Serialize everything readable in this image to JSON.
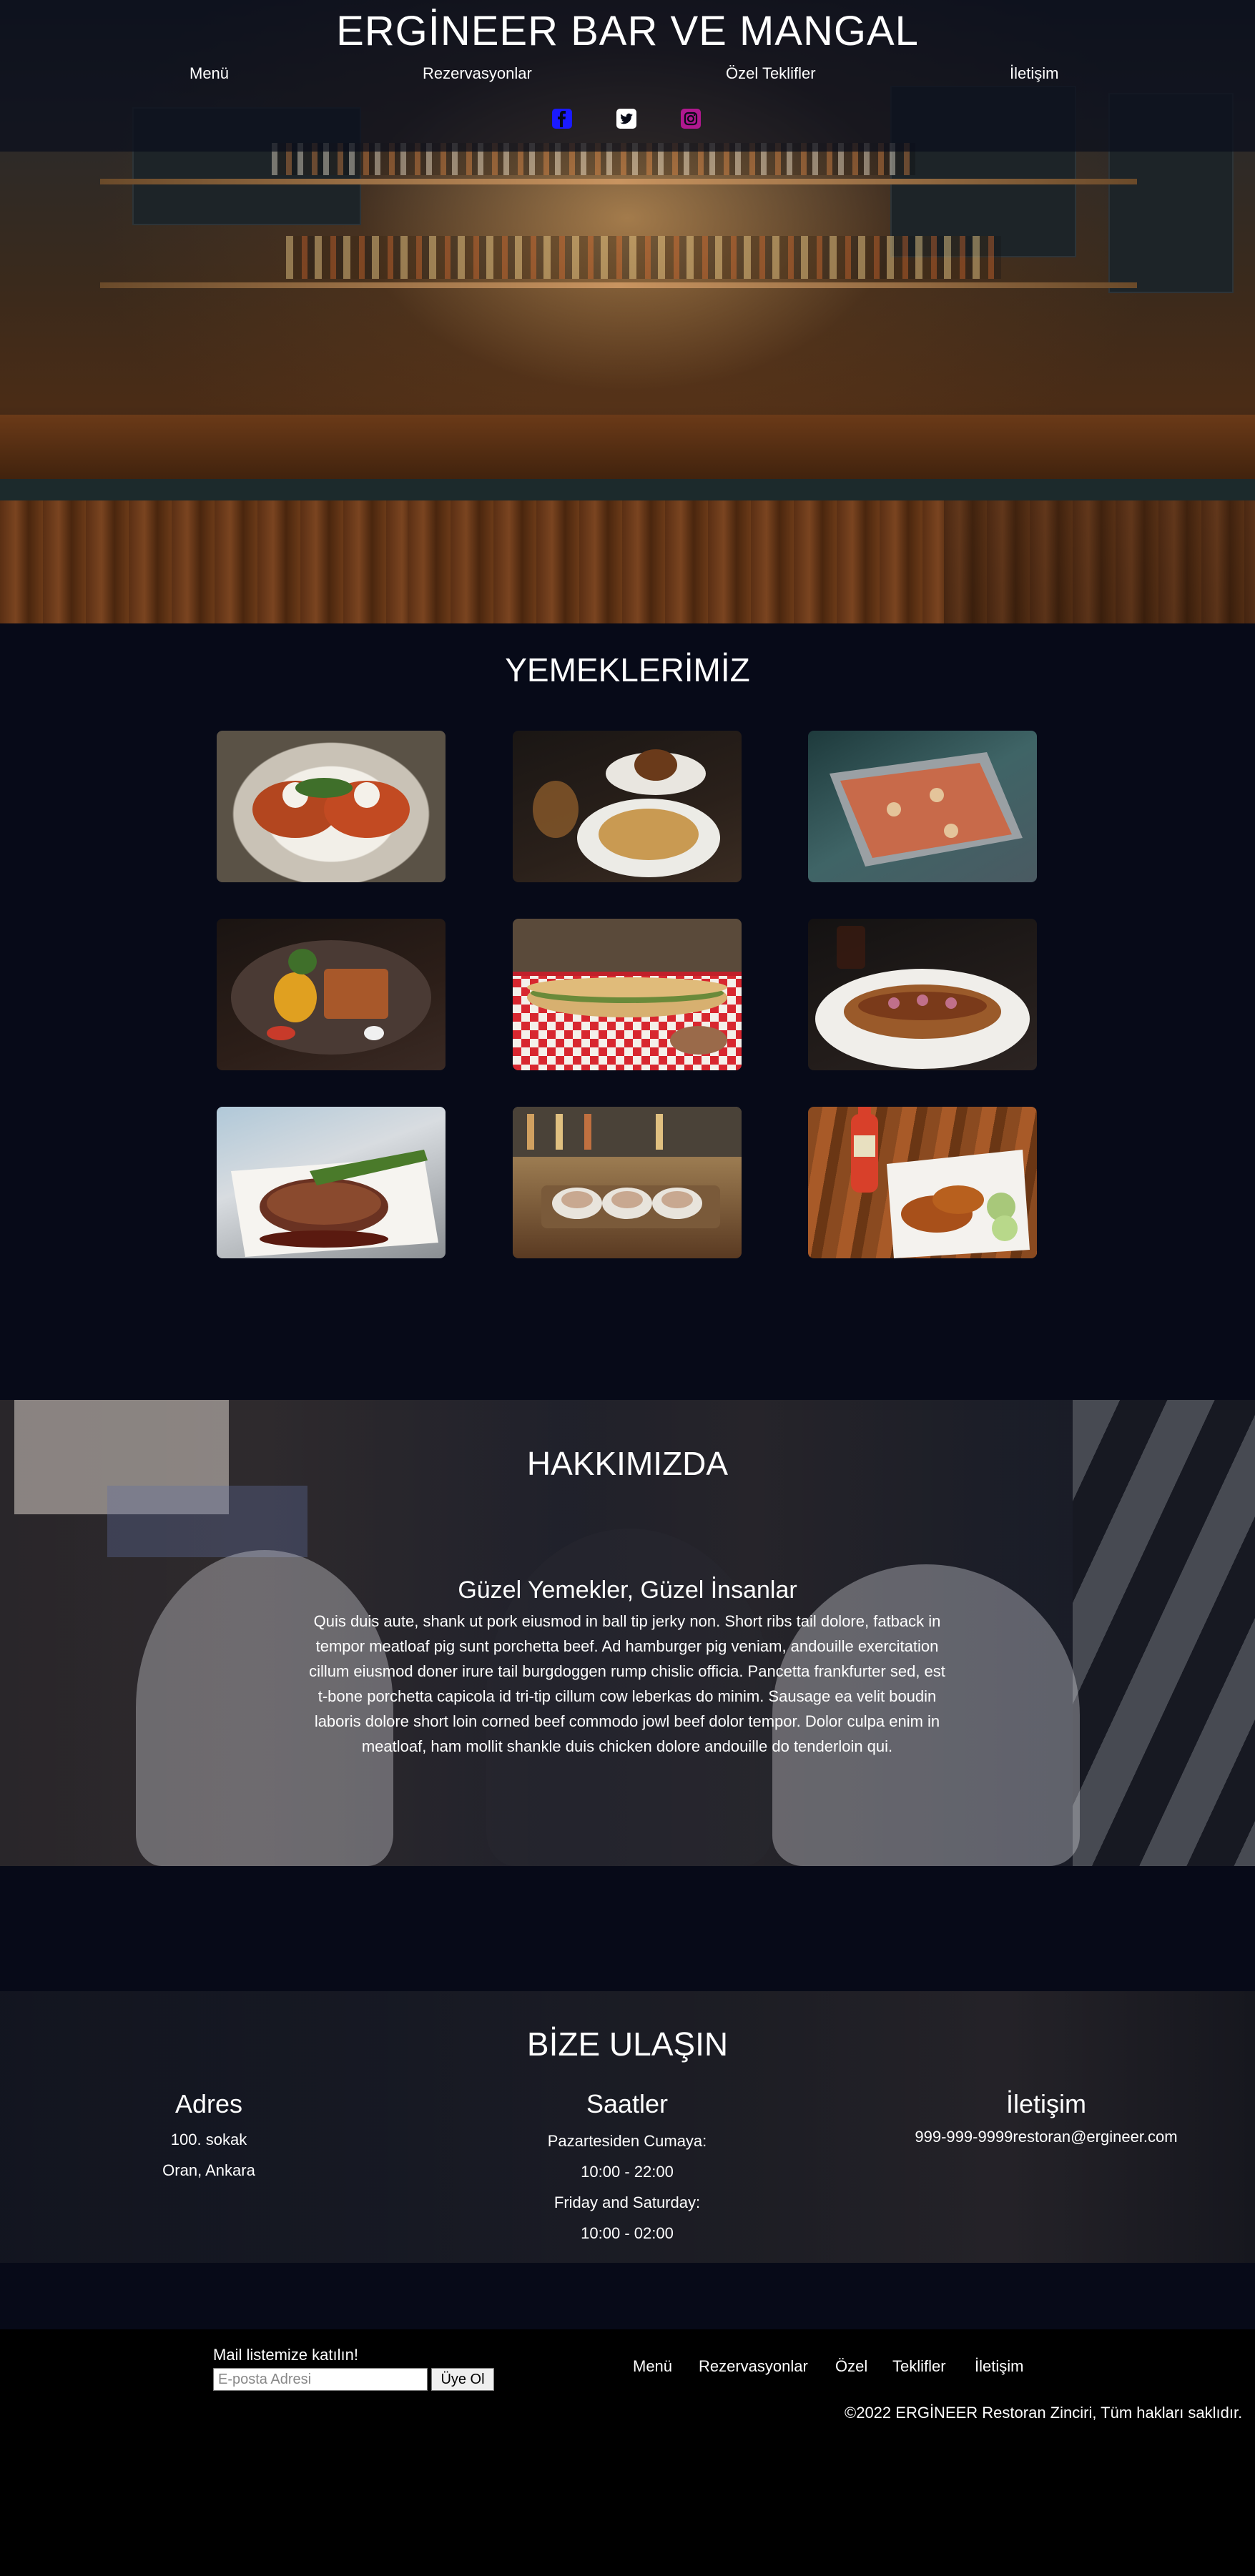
{
  "header": {
    "title": "ERGİNEER BAR VE MANGAL",
    "nav": [
      "Menü",
      "Rezervasyonlar",
      "Özel Teklifler",
      "İletişim"
    ],
    "social_icons": [
      {
        "name": "facebook-icon",
        "color": "#1a1aff"
      },
      {
        "name": "twitter-icon",
        "color": "#ffffff"
      },
      {
        "name": "instagram-icon",
        "color": "#b0188f"
      }
    ]
  },
  "menu_section": {
    "title": "YEMEKLERİMİZ",
    "images": [
      "bruschetta-plate",
      "burger-and-baked-dish",
      "pizza-on-tray",
      "pork-belly-plate",
      "sandwich-on-checkered-paper",
      "stuffed-bread-on-plate",
      "steak-with-asparagus",
      "oysters-on-board",
      "chicken-wings-with-drink"
    ]
  },
  "about": {
    "title": "HAKKIMIZDA",
    "subtitle": "Güzel Yemekler, Güzel İnsanlar",
    "text": "Quis duis aute, shank ut pork eiusmod in ball tip jerky non. Short ribs tail dolore, fatback in tempor meatloaf pig sunt porchetta beef. Ad hamburger pig veniam, andouille exercitation cillum eiusmod doner irure tail burgdoggen rump chislic officia. Pancetta frankfurter sed, est t-bone porchetta capicola id tri-tip cillum cow leberkas do minim. Sausage ea velit boudin laboris dolore short loin corned beef commodo jowl beef dolor tempor. Dolor culpa enim in meatloaf, ham mollit shankle duis chicken dolore andouille do tenderloin qui."
  },
  "contact": {
    "title": "BİZE ULAŞIN",
    "address": {
      "heading": "Adres",
      "lines": [
        "100. sokak",
        "Oran, Ankara"
      ]
    },
    "hours": {
      "heading": "Saatler",
      "lines": [
        "Pazartesiden Cumaya:",
        "10:00 - 22:00",
        "Friday and Saturday:",
        "10:00 - 02:00"
      ]
    },
    "contact": {
      "heading": "İletişim",
      "phone": "999-999-9999",
      "email": "restoran@ergineer.com"
    }
  },
  "footer": {
    "newsletter_label": "Mail listemize katılın!",
    "email_placeholder": "E-posta Adresi",
    "subscribe_label": "Üye Ol",
    "links": [
      "Menü",
      "Rezervasyonlar",
      "Özel",
      "Teklifler",
      "İletişim"
    ],
    "copyright": "©2022 ERGİNEER Restoran Zinciri, Tüm hakları saklıdır."
  }
}
